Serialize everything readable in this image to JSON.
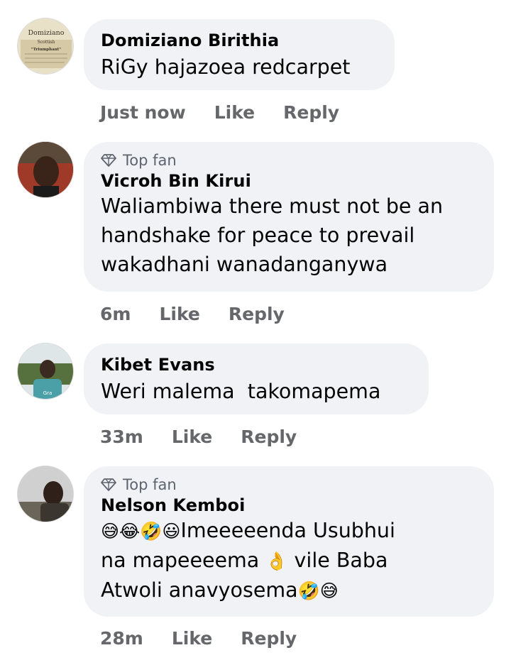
{
  "comments": [
    {
      "author": "Domiziano Birithia",
      "badge": "",
      "lines": [
        "RiGy hajazoea redcarpet"
      ],
      "time": "Just now",
      "like": "Like",
      "reply": "Reply",
      "avatar_text": {
        "title": "Domiziano",
        "l1": "Scottish",
        "l2": "\"Triumphant\""
      }
    },
    {
      "author": "Vicroh Bin Kirui",
      "badge": "Top fan",
      "lines": [
        "Waliambiwa there must not be an",
        "handshake for peace to prevail",
        "wakadhani wanadanganywa"
      ],
      "time": "6m",
      "like": "Like",
      "reply": "Reply"
    },
    {
      "author": "Kibet Evans",
      "badge": "",
      "lines": [
        "Weri malema  takomapema"
      ],
      "time": "33m",
      "like": "Like",
      "reply": "Reply"
    },
    {
      "author": "Nelson Kemboi",
      "badge": "Top fan",
      "lines": [
        {
          "emoji_before": "😅😂🤣😃",
          "text": "Imeeeeenda Usubhui"
        },
        {
          "text": "na mapeeeema",
          "emoji_mid": "👌",
          "text2": " vile Baba"
        },
        {
          "text": "Atwoli anavyosema",
          "emoji_after": "🤣😅"
        }
      ],
      "time": "28m",
      "like": "Like",
      "reply": "Reply"
    }
  ],
  "icons": {
    "top_fan": "diamond-icon"
  },
  "colors": {
    "bubble": "#f0f2f5",
    "meta": "#65676b",
    "badge": "#5d6470"
  }
}
